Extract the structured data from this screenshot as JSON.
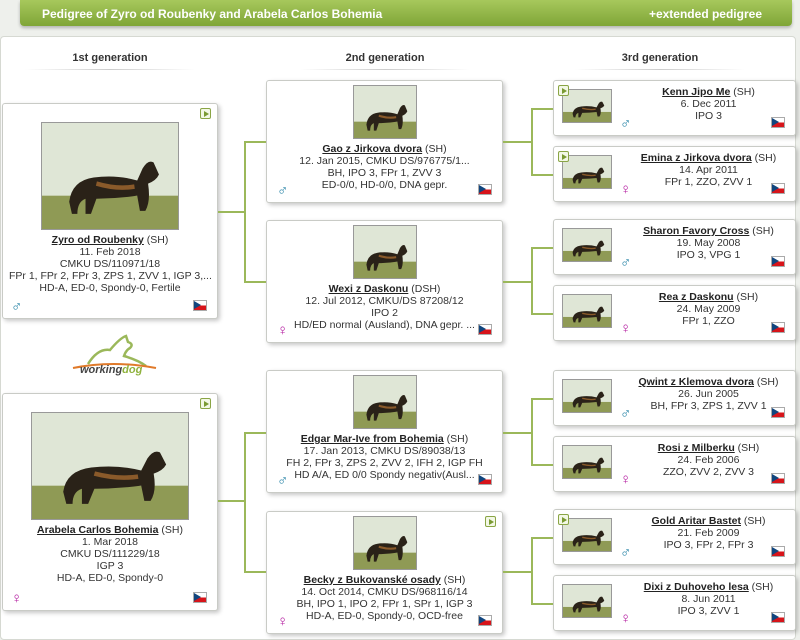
{
  "header": {
    "title": "Pedigree of Zyro od Roubenky and Arabela Carlos Bohemia",
    "extended_link": "+extended pedigree"
  },
  "generations": [
    "1st generation",
    "2nd generation",
    "3rd generation"
  ],
  "logo": {
    "text_a": "working",
    "text_b": "dog"
  },
  "gen1": [
    {
      "name": "Zyro od Roubenky",
      "breed": " (SH)",
      "lines": [
        "11. Feb 2018",
        "CMKU DS/110971/18",
        "FPr 1, FPr 2, FPr 3, ZPS 1, ZVV 1, IGP 3,...",
        "HD-A, ED-0, Spondy-0, Fertile"
      ],
      "sex": "♂"
    },
    {
      "name": "Arabela Carlos Bohemia",
      "breed": " (SH)",
      "lines": [
        "1. Mar 2018",
        "CMKU DS/111229/18",
        "IGP 3",
        "HD-A, ED-0, Spondy-0"
      ],
      "sex": "♀"
    }
  ],
  "gen2": [
    {
      "name": "Gao z Jirkova dvora",
      "breed": " (SH)",
      "lines": [
        "12. Jan 2015, CMKU DS/976775/1...",
        "BH, IPO 3, FPr 1, ZVV 3",
        "ED-0/0, HD-0/0, DNA gepr."
      ],
      "sex": "♂"
    },
    {
      "name": "Wexi z Daskonu",
      "breed": " (DSH)",
      "lines": [
        "12. Jul 2012, CMKU/DS 87208/12",
        "IPO 2",
        "HD/ED normal (Ausland), DNA gepr. ..."
      ],
      "sex": "♀"
    },
    {
      "name": "Edgar Mar-Ive from Bohemia",
      "breed": " (SH)",
      "lines": [
        "17. Jan 2013, CMKU DS/89038/13",
        "FH 2, FPr 3, ZPS 2, ZVV 2, IFH 2, IGP FH",
        "HD A/A, ED 0/0 Spondy negativ(Ausl..."
      ],
      "sex": "♂"
    },
    {
      "name": "Becky z Bukovanské osady",
      "breed": " (SH)",
      "lines": [
        "14. Oct 2014, CMKU DS/968116/14",
        "BH, IPO 1, IPO 2, FPr 1, SPr 1, IGP 3",
        "HD-A, ED-0, Spondy-0, OCD-free"
      ],
      "sex": "♀"
    }
  ],
  "gen3": [
    {
      "name": "Kenn Jipo Me",
      "breed": " (SH)",
      "lines": [
        "6. Dec 2011",
        "IPO 3"
      ],
      "sex": "♂"
    },
    {
      "name": "Emina z Jirkova dvora",
      "breed": " (SH)",
      "lines": [
        "14. Apr 2011",
        "FPr 1, ZZO, ZVV 1"
      ],
      "sex": "♀"
    },
    {
      "name": "Sharon Favory Cross",
      "breed": " (SH)",
      "lines": [
        "19. May 2008",
        "IPO 3, VPG 1"
      ],
      "sex": "♂"
    },
    {
      "name": "Rea z Daskonu",
      "breed": " (SH)",
      "lines": [
        "24. May 2009",
        "FPr 1, ZZO"
      ],
      "sex": "♀"
    },
    {
      "name": "Qwint z Klemova dvora",
      "breed": " (SH)",
      "lines": [
        "26. Jun 2005",
        "BH, FPr 3, ZPS 1, ZVV 1"
      ],
      "sex": "♂"
    },
    {
      "name": "Rosi z Milberku",
      "breed": " (SH)",
      "lines": [
        "24. Feb 2006",
        "ZZO, ZVV 2, ZVV 3"
      ],
      "sex": "♀"
    },
    {
      "name": "Gold Aritar Bastet",
      "breed": " (SH)",
      "lines": [
        "21. Feb 2009",
        "IPO 3, FPr 2, FPr 3"
      ],
      "sex": "♂"
    },
    {
      "name": "Dixi z Duhoveho lesa",
      "breed": " (SH)",
      "lines": [
        "8. Jun 2011",
        "IPO 3, ZVV 1"
      ],
      "sex": "♀"
    }
  ]
}
